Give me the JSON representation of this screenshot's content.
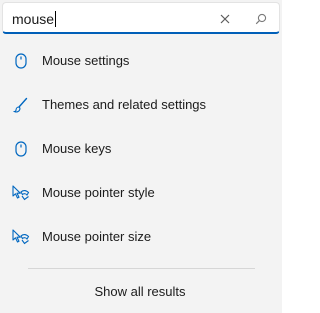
{
  "search": {
    "value": "mouse",
    "clear_icon": "close-icon",
    "search_icon": "search-icon"
  },
  "results": [
    {
      "label": "Mouse settings",
      "icon": "mouse-icon"
    },
    {
      "label": "Themes and related settings",
      "icon": "brush-icon"
    },
    {
      "label": "Mouse keys",
      "icon": "mouse-icon"
    },
    {
      "label": "Mouse pointer style",
      "icon": "pointer-icon"
    },
    {
      "label": "Mouse pointer size",
      "icon": "pointer-icon"
    }
  ],
  "footer": {
    "show_all_label": "Show all results"
  },
  "colors": {
    "accent": "#005fb8",
    "icon": "#0067c0"
  }
}
